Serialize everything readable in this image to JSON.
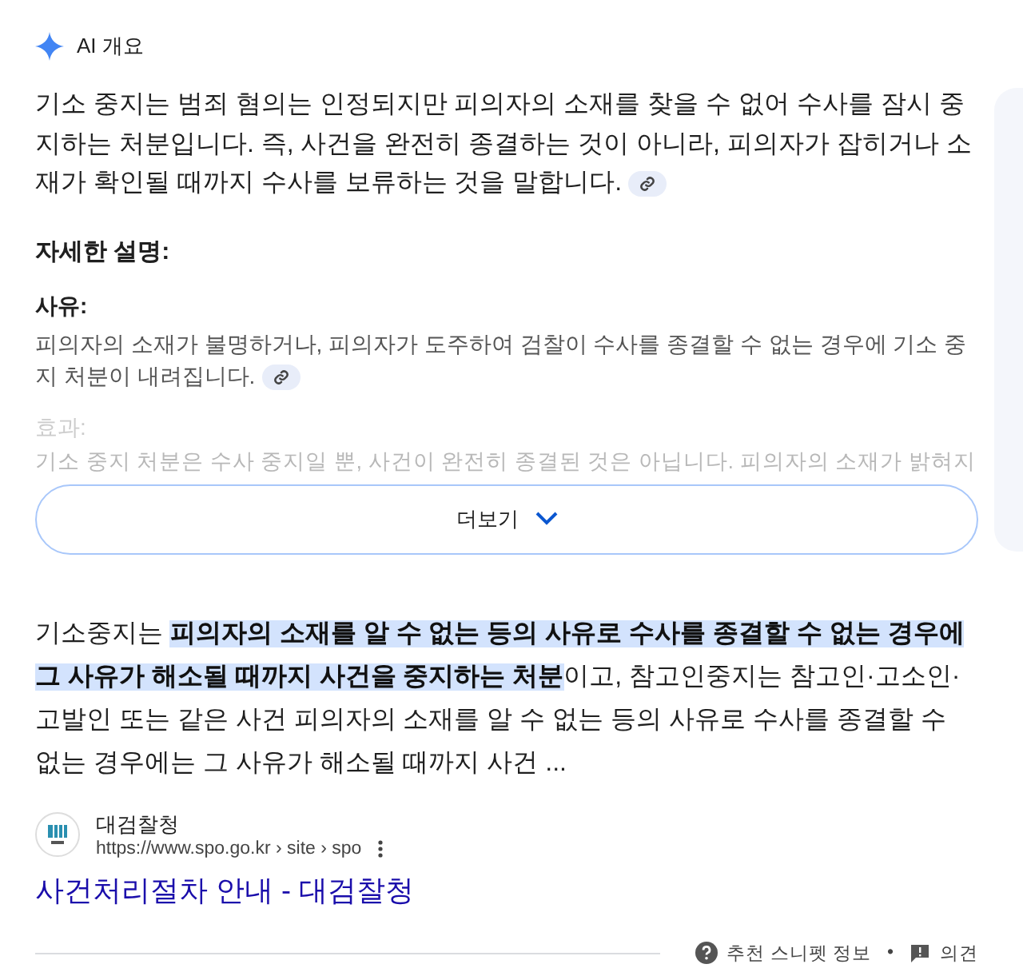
{
  "overview": {
    "title": "AI 개요",
    "summary": "기소 중지는 범죄 혐의는 인정되지만 피의자의 소재를 찾을 수 없어 수사를 잠시 중지하는 처분입니다. 즉, 사건을 완전히 종결하는 것이 아니라, 피의자가 잡히거나 소재가 확인될 때까지 수사를 보류하는 것을 말합니다.",
    "details_heading": "자세한 설명:",
    "sections": [
      {
        "label": "사유:",
        "text": "피의자의 소재가 불명하거나, 피의자가 도주하여 검찰이 수사를 종결할 수 없는 경우에 기소 중지 처분이 내려집니다.",
        "faded": false
      },
      {
        "label": "효과:",
        "text": "기소 중지 처분은 수사 중지일 뿐, 사건이 완전히 종결된 것은 아닙니다. 피의자의 소재가 밝혀지",
        "faded": true
      }
    ],
    "more_button": "더보기"
  },
  "snippet": {
    "text": "기소중지는 **피의자의 소재를 알 수 없는 등의 사유로 수사를 종결할 수 없는 경우에 그 사유가 해소될 때까지 사건을 중지하는 처분**이고, 참고인중지는 참고인·고소인·고발인 또는 같은 사건 피의자의 소재를 알 수 없는 등의 사유로 수사를 종결할 수 없는 경우에는 그 사유가 해소될 때까지 사건 ...",
    "source_name": "대검찰청",
    "url": "https://www.spo.go.kr › site › spo",
    "title": "사건처리절차 안내 - 대검찰청"
  },
  "footer": {
    "about": "추천 스니펫 정보",
    "separator": "•",
    "feedback": "의견"
  }
}
